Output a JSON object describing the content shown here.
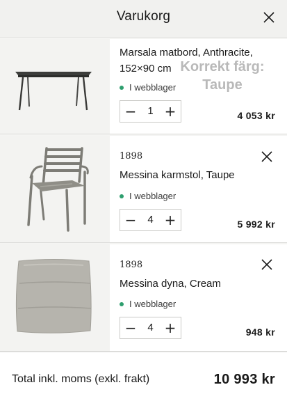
{
  "header": {
    "title": "Varukorg",
    "close_icon": "close-icon"
  },
  "overlay_note": {
    "line1": "Korrekt färg:",
    "line2": "Taupe"
  },
  "items": [
    {
      "brand": "",
      "name_line1": "Marsala matbord, Anthracite,",
      "name_line2": "152×90 cm",
      "stock": "I webblager",
      "quantity": "1",
      "price": "4 053 kr",
      "image_icon": "table-image"
    },
    {
      "brand": "1898",
      "name_line1": "Messina karmstol, Taupe",
      "name_line2": "",
      "stock": "I webblager",
      "quantity": "4",
      "price": "5 992 kr",
      "image_icon": "armchair-image"
    },
    {
      "brand": "1898",
      "name_line1": "Messina dyna, Cream",
      "name_line2": "",
      "stock": "I webblager",
      "quantity": "4",
      "price": "948 kr",
      "image_icon": "cushion-image"
    }
  ],
  "stepper": {
    "minus": "−",
    "plus": "+"
  },
  "footer": {
    "total_label": "Total inkl. moms (exkl. frakt)",
    "total_value": "10 993 kr"
  },
  "colors": {
    "stock_dot": "#2e9e6e",
    "background": "#f4f4f2",
    "card": "#ffffff"
  }
}
